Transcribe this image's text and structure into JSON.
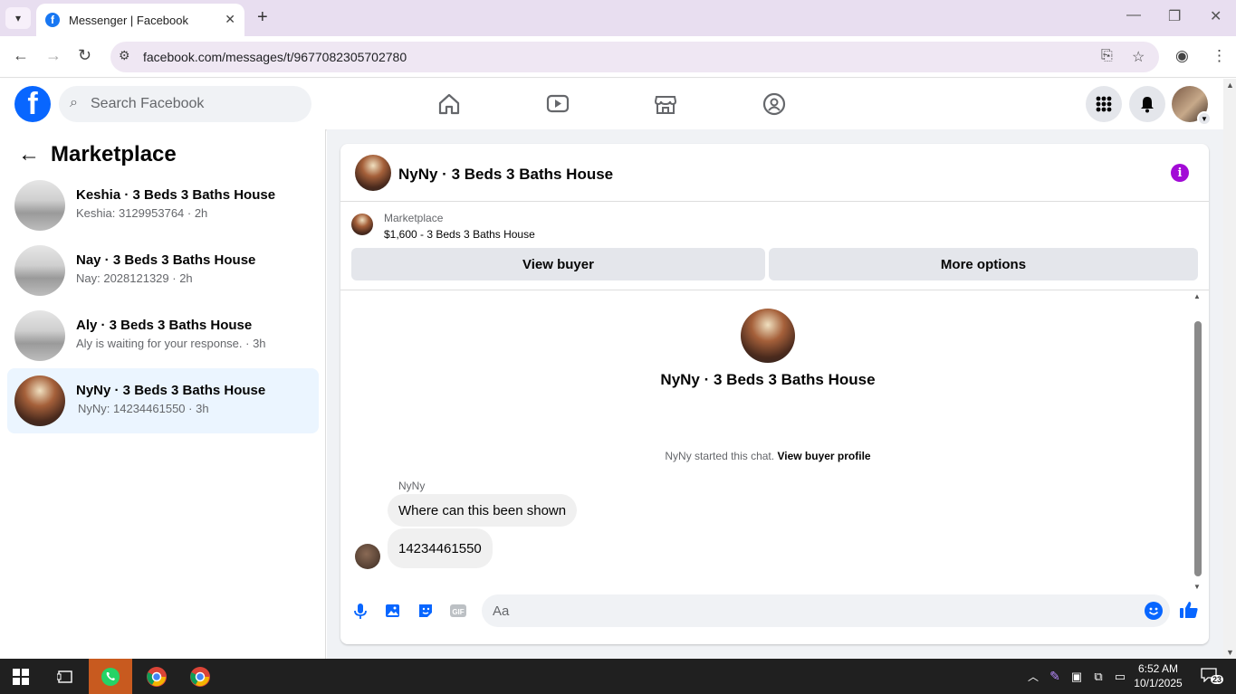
{
  "browser": {
    "tab_title": "Messenger | Facebook",
    "url": "facebook.com/messages/t/9677082305702780"
  },
  "fb": {
    "search_placeholder": "Search Facebook"
  },
  "left": {
    "heading": "Marketplace",
    "conversations": [
      {
        "name": "Keshia · 3 Beds 3 Baths House",
        "sub": "Keshia: 3129953764 · 2h",
        "active": false
      },
      {
        "name": "Nay · 3 Beds 3 Baths House",
        "sub": "Nay: 2028121329 · 2h",
        "active": false
      },
      {
        "name": "Aly · 3 Beds 3 Baths House",
        "sub": "Aly is waiting for your response. · 3h",
        "active": false
      },
      {
        "name": "NyNy · 3 Beds 3 Baths House",
        "sub": "NyNy: 14234461550 · 3h",
        "active": true
      }
    ]
  },
  "chat": {
    "title": "NyNy · 3 Beds 3 Baths House",
    "listing_label": "Marketplace",
    "listing_price": "$1,600 - 3 Beds 3 Baths House",
    "view_buyer": "View buyer",
    "more_options": "More options",
    "center_title": "NyNy · 3 Beds 3 Baths House",
    "started_text": "NyNy started this chat.",
    "view_profile": "View buyer profile",
    "sender": "NyNy",
    "messages": [
      "Where can this been shown",
      "14234461550"
    ],
    "input_placeholder": "Aa"
  },
  "taskbar": {
    "time": "6:52 AM",
    "date": "10/1/2025",
    "notifications": "23"
  },
  "colors": {
    "fb_blue": "#0866ff",
    "active_bg": "#ebf5ff",
    "info_purple": "#a20bd6"
  }
}
